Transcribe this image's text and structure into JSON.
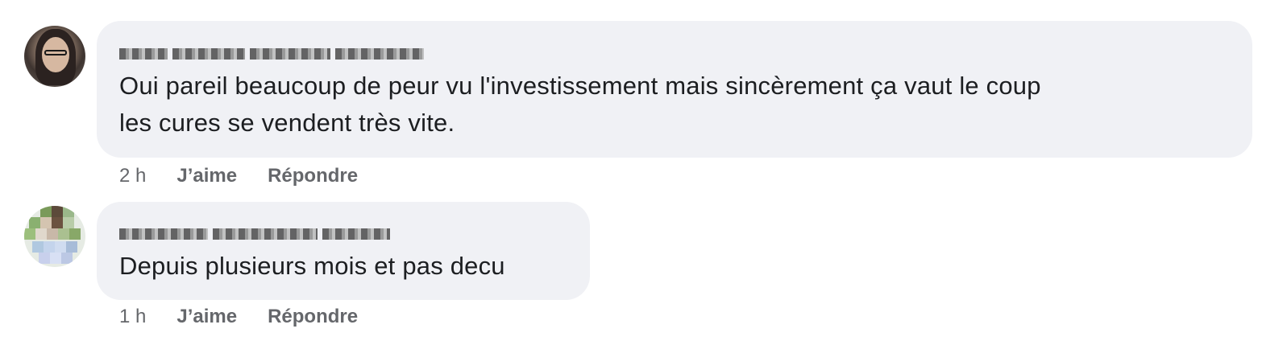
{
  "comments": [
    {
      "author_redacted": true,
      "text_line1": "Oui pareil beaucoup de peur vu l'investissement mais sincèrement ça vaut le coup",
      "text_line2": "les cures se vendent très vite.",
      "time": "2 h",
      "like_label": "J’aime",
      "reply_label": "Répondre"
    },
    {
      "author_redacted": true,
      "text_line1": "Depuis plusieurs mois et pas decu",
      "time": "1 h",
      "like_label": "J’aime",
      "reply_label": "Répondre"
    }
  ],
  "colors": {
    "bubble": "#f0f1f5",
    "text": "#1c1e21",
    "meta": "#65676b"
  }
}
